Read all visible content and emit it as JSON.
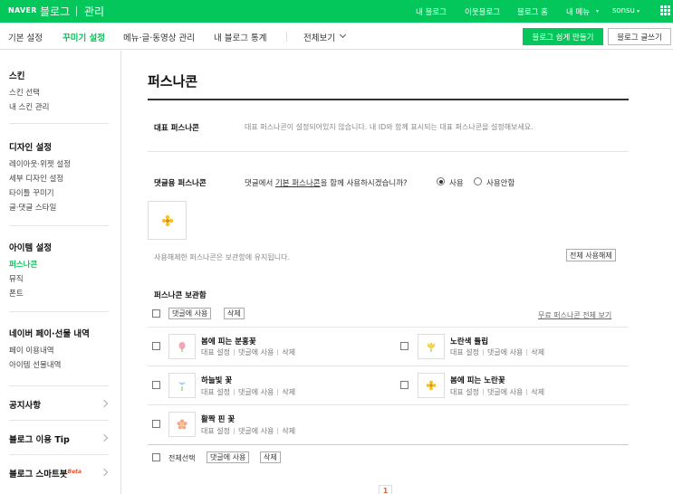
{
  "topbar": {
    "logo": "NAVER",
    "blog": "블로그",
    "manage": "관리",
    "nav": [
      "내 블로그",
      "이웃블로그",
      "블로그 홈",
      "내 메뉴",
      "sonsu"
    ]
  },
  "subnav": {
    "tabs": [
      "기본 설정",
      "꾸미기 설정",
      "메뉴·글·동영상 관리",
      "내 블로그 통계",
      "전체보기"
    ],
    "easy_button": "블로그 쉽게 만들기",
    "write_button": "블로그 글쓰기"
  },
  "sidebar": {
    "sections": [
      {
        "title": "스킨",
        "items": [
          "스킨 선택",
          "내 스킨 관리"
        ]
      },
      {
        "title": "디자인 설정",
        "items": [
          "레이아웃·위젯 설정",
          "세부 디자인 설정",
          "타이틀 꾸미기",
          "글·댓글 스타일"
        ]
      },
      {
        "title": "아이템 설정",
        "items": [
          "퍼스나콘",
          "뮤직",
          "폰트"
        ]
      },
      {
        "title": "네이버 페이·선물 내역",
        "items": [
          "페이 이용내역",
          "아이템 선물내역"
        ]
      }
    ],
    "rows": [
      "공지사항",
      "블로그 이용 Tip",
      "블로그 스마트봇"
    ],
    "beta": "Beta"
  },
  "main": {
    "title": "퍼스나콘",
    "rep": {
      "label": "대표 퍼스나콘",
      "desc": "대표 퍼스나콘이 설정되어있지 않습니다. 내 ID와 함께 표시되는 대표 퍼스나콘을 설정해보세요."
    },
    "comment": {
      "label": "댓글용 퍼스나콘",
      "q1": "댓글에서 ",
      "qlink": "기본 퍼스나콘",
      "q2": "을 함께 사용하시겠습니까?",
      "opt_use": "사용",
      "opt_nouse": "사용안함",
      "note": "사용해제한 퍼스나콘은 보관함에 유지됩니다.",
      "release_all": "전체 사용해제"
    },
    "box": {
      "title": "퍼스나콘 보관함",
      "use_btn": "댓글에 사용",
      "del_btn": "삭제",
      "free_link": "무료 퍼스나콘 전체 보기",
      "items": [
        {
          "name": "봄에 피는 분홍꽃",
          "icon": "pink-flower-icon",
          "color": "#f4a6b8"
        },
        {
          "name": "노란색 튤립",
          "icon": "yellow-tulip-icon",
          "color": "#f5d547"
        },
        {
          "name": "하늘빛 꽃",
          "icon": "skyblue-flower-icon",
          "color": "#9fd3e8"
        },
        {
          "name": "봄에 피는 노란꽃",
          "icon": "yellow-flower-icon",
          "color": "#f7c21a"
        },
        {
          "name": "활짝 핀 꽃",
          "icon": "blooming-flower-icon",
          "color": "#f7a58f"
        }
      ],
      "act_rep": "대표 설정",
      "act_use": "댓글에 사용",
      "act_del": "삭제",
      "select_all": "전체선택"
    },
    "page": "1"
  }
}
